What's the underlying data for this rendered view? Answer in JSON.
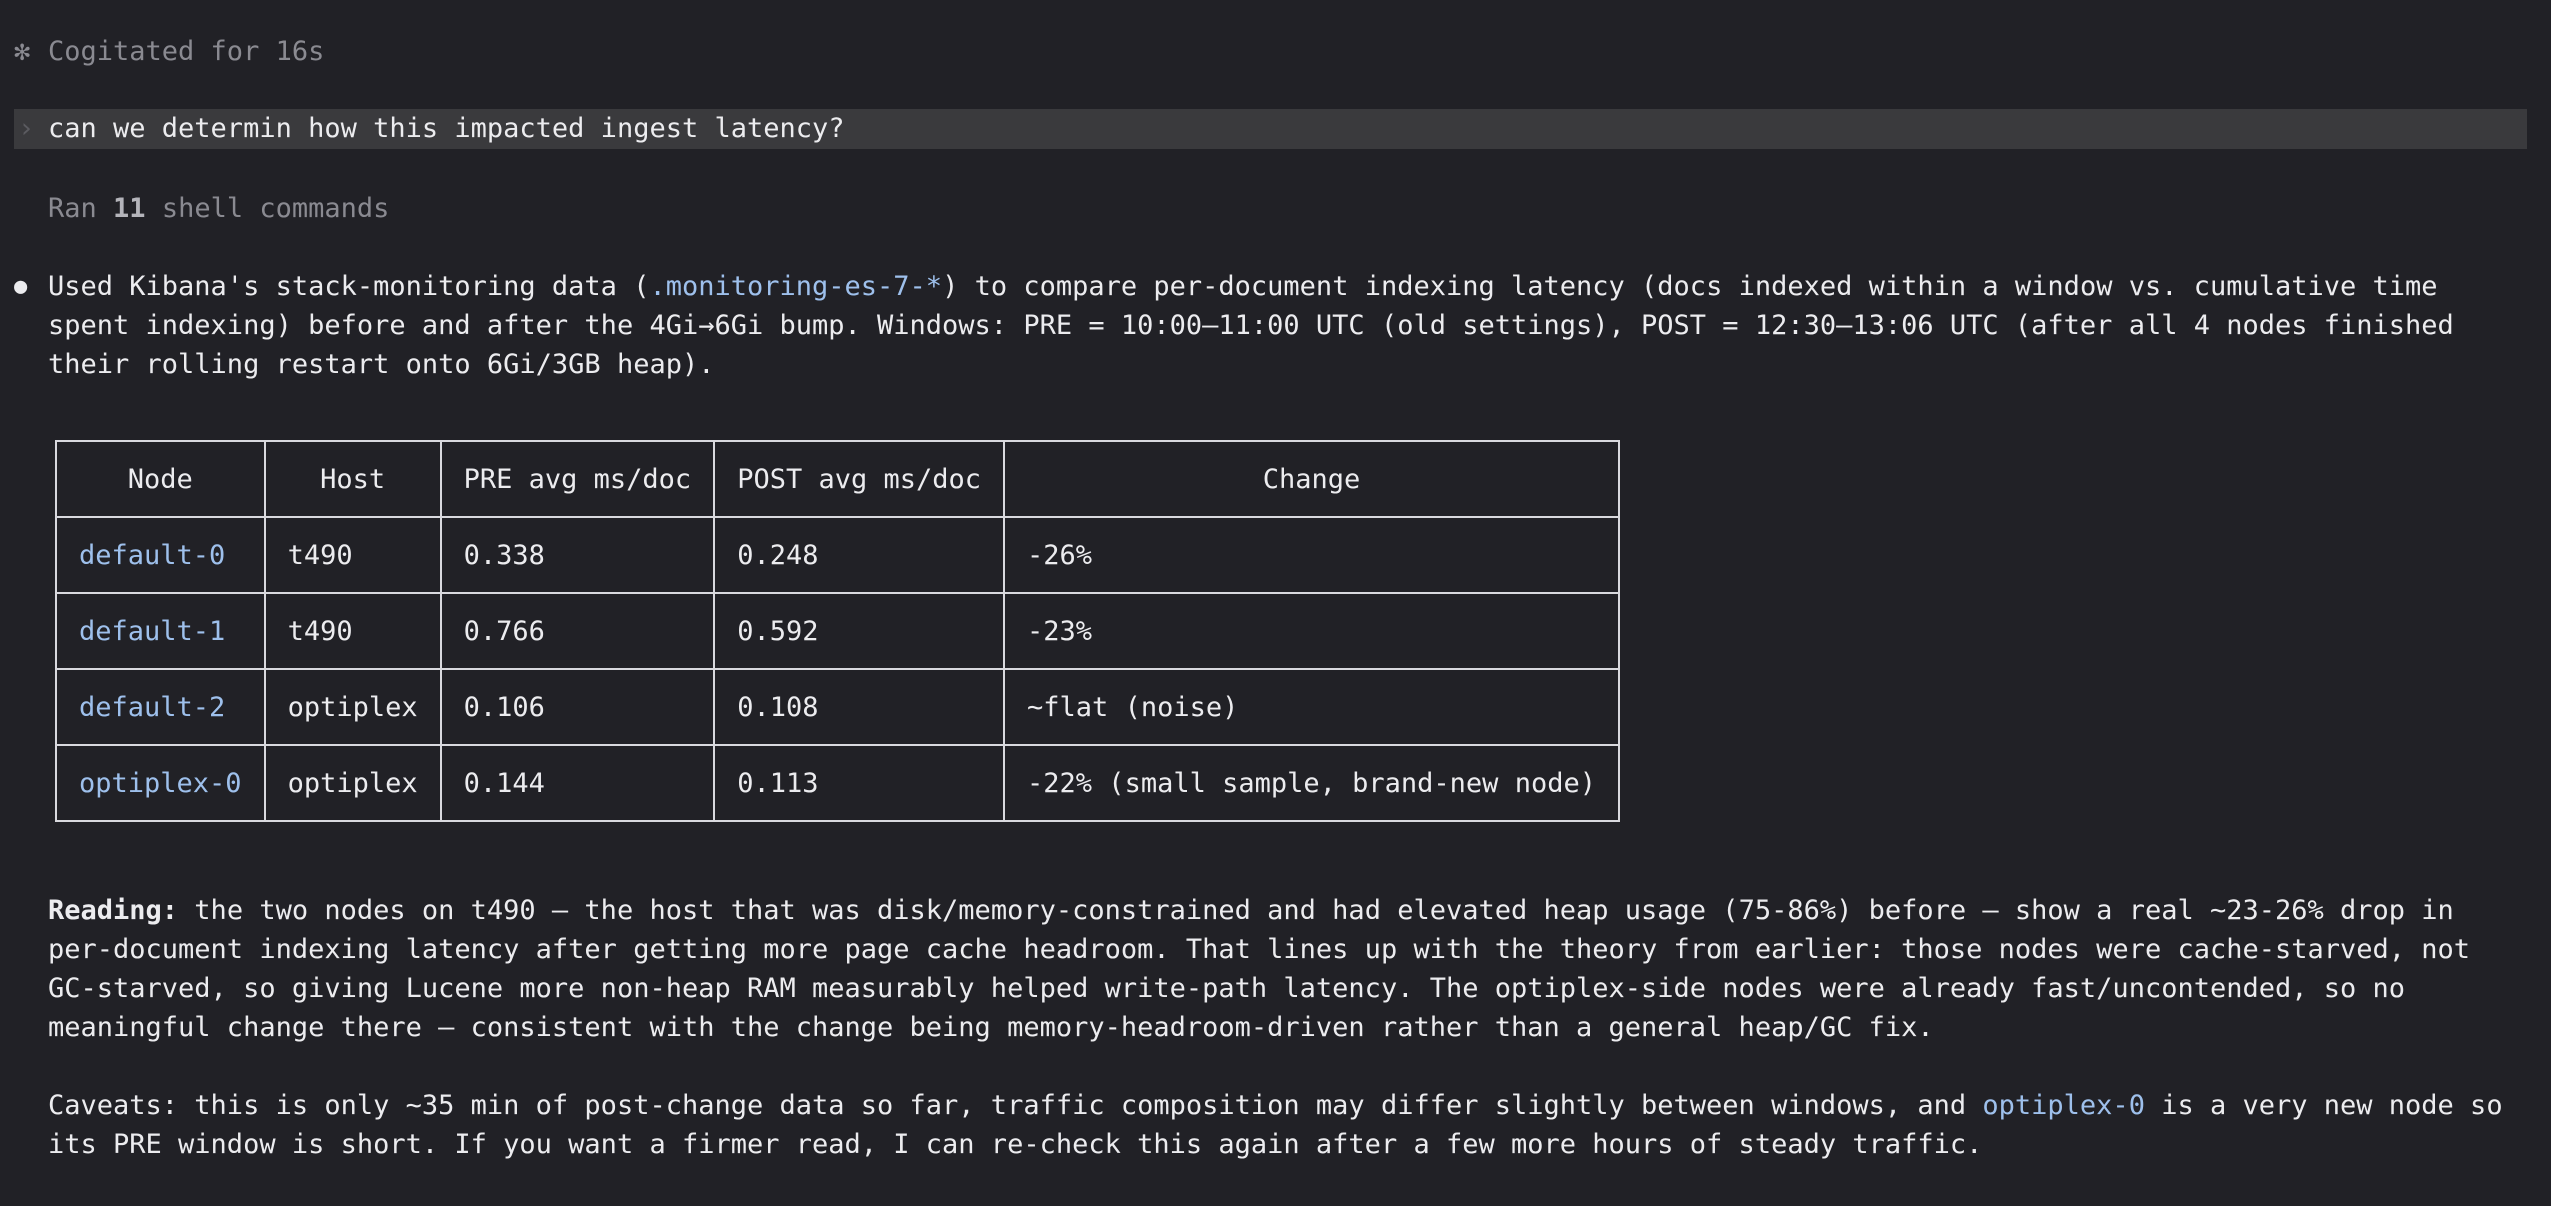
{
  "status": {
    "icon": "asterisk-spinner-icon",
    "glyph": "✻",
    "text": "Cogitated for 16s"
  },
  "user_message": {
    "prompt_glyph": "›",
    "text": "can we determin how this impacted ingest latency?"
  },
  "tool_summary": {
    "prefix": "Ran",
    "count": "11",
    "suffix": "shell commands"
  },
  "response": {
    "bullet": "●",
    "intro": {
      "part1": "Used Kibana's stack-monitoring data (",
      "code": ".monitoring-es-7-*",
      "part2": ") to compare per-document indexing latency (docs indexed within a window vs. cumulative time spent indexing) before and after the 4Gi→6Gi bump. Windows: PRE = 10:00–11:00 UTC (old settings), POST = 12:30–13:06 UTC (after all 4 nodes finished their rolling restart onto 6Gi/3GB heap)."
    },
    "table": {
      "headers": [
        "Node",
        "Host",
        "PRE avg ms/doc",
        "POST avg ms/doc",
        "Change"
      ],
      "rows": [
        {
          "node": "default-0",
          "host": "t490",
          "pre": "0.338",
          "post": "0.248",
          "change": "-26%",
          "bold": true
        },
        {
          "node": "default-1",
          "host": "t490",
          "pre": "0.766",
          "post": "0.592",
          "change": "-23%",
          "bold": true
        },
        {
          "node": "default-2",
          "host": "optiplex",
          "pre": "0.106",
          "post": "0.108",
          "change": "~flat (noise)",
          "bold": false
        },
        {
          "node": "optiplex-0",
          "host": "optiplex",
          "pre": "0.144",
          "post": "0.113",
          "change": "-22% (small sample, brand-new node)",
          "bold": false
        }
      ]
    },
    "reading": {
      "label": "Reading:",
      "text": " the two nodes on t490 — the host that was disk/memory-constrained and had elevated heap usage (75-86%) before — show a real ~23-26% drop in per-document indexing latency after getting more page cache headroom. That lines up with the theory from earlier: those nodes were cache-starved, not GC-starved, so giving Lucene more non-heap RAM measurably helped write-path latency. The optiplex-side nodes were already fast/uncontended, so no meaningful change there — consistent with the change being memory-headroom-driven rather than a general heap/GC fix."
    },
    "caveats": {
      "part1": "Caveats: this is only ~35 min of post-change data so far, traffic composition may differ slightly between windows, and ",
      "code": "optiplex-0",
      "part2": " is a very new node so its PRE window is short. If you want a firmer read, I can re-check this again after a few more hours of steady traffic."
    }
  },
  "colors": {
    "background": "#212126",
    "text": "#ececef",
    "muted": "#8a8a91",
    "code": "#9ec0ec",
    "user_bar": "#3a3a3d",
    "table_border": "#d9d9de"
  }
}
